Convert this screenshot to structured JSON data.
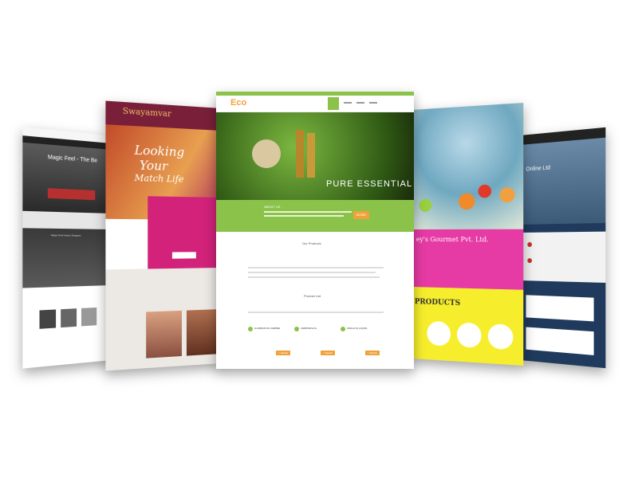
{
  "shot1": {
    "hero_title": "Magic Feel - The Be",
    "caption_small": "Magic Feel Interior Designer"
  },
  "shot2": {
    "brand": "Swayamvar",
    "hero_line1": "Looking",
    "hero_line2": "Your",
    "hero_line3": "Match Life"
  },
  "shot3": {
    "logo": "Eco",
    "hero_text": "PURE ESSENTIAL OILS",
    "about_title": "ABOUT US",
    "about_button": "MORE",
    "section_products": "Our Products",
    "section_list": "Product List",
    "product_items": [
      "ALUMINIUM OIL (CARBIDE)",
      "CARBONATE OIL",
      "VANILLA OIL (LIQUID)"
    ],
    "product_button": "> Details"
  },
  "shot4": {
    "title_partial": "ey's Gourmet Pvt. Ltd.",
    "products_label": "PRODUCTS"
  },
  "shot5": {
    "header_text": "Online Ltd"
  },
  "colors": {
    "green": "#8bc34a",
    "orange": "#f0a23a",
    "pink": "#e63aa5",
    "yellow": "#f6ee2c",
    "maroon": "#7a1f3a",
    "dark": "#2b2b2b",
    "navy": "#1f3a5c"
  }
}
